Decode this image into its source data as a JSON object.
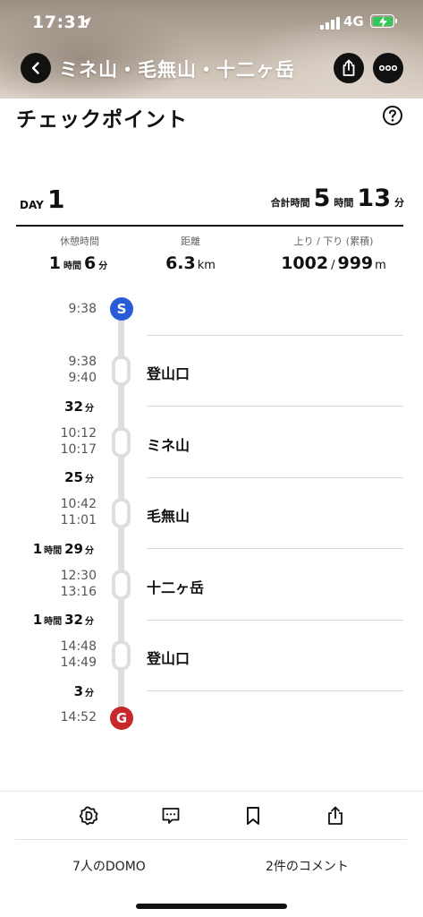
{
  "status_bar": {
    "time": "17:31",
    "network": "4G"
  },
  "header": {
    "title": "ミネ山・毛無山・十二ヶ岳",
    "back_icon": "chevron-left-icon",
    "share_icon": "share-icon",
    "more_icon": "more-dots-icon"
  },
  "checkpoint": {
    "title": "チェックポイント",
    "help_icon": "help-circle-icon",
    "day_label": "DAY",
    "day_number": "1",
    "total_label": "合計時間",
    "total_hours": "5",
    "hours_unit": "時間",
    "total_minutes": "13",
    "minutes_unit": "分",
    "stats": {
      "rest": {
        "label": "休憩時間",
        "hours": "1",
        "hours_unit": "時間",
        "minutes": "6",
        "minutes_unit": "分"
      },
      "distance": {
        "label": "距離",
        "value": "6.3",
        "unit": "km"
      },
      "elevation": {
        "label": "上り / 下り (累積)",
        "up": "1002",
        "separator": "/",
        "down": "999",
        "unit": "m"
      }
    }
  },
  "timeline": {
    "start": {
      "marker": "S",
      "time": "9:38"
    },
    "checkpoints": [
      {
        "arrive": "9:38",
        "depart": "9:40",
        "name": "登山口"
      },
      {
        "arrive": "10:12",
        "depart": "10:17",
        "name": "ミネ山"
      },
      {
        "arrive": "10:42",
        "depart": "11:01",
        "name": "毛無山"
      },
      {
        "arrive": "12:30",
        "depart": "13:16",
        "name": "十二ヶ岳"
      },
      {
        "arrive": "14:48",
        "depart": "14:49",
        "name": "登山口"
      }
    ],
    "durations": [
      {
        "hours": "",
        "minutes": "32"
      },
      {
        "hours": "",
        "minutes": "25"
      },
      {
        "hours": "1",
        "minutes": "29"
      },
      {
        "hours": "1",
        "minutes": "32"
      },
      {
        "hours": "",
        "minutes": "3"
      }
    ],
    "hours_unit": "時間",
    "minutes_unit": "分",
    "goal": {
      "marker": "G",
      "time": "14:52"
    }
  },
  "bottom_bar": {
    "actions": [
      "domo-icon",
      "comment-icon",
      "bookmark-icon",
      "share-icon"
    ],
    "domo_count_label": "7人のDOMO",
    "comment_count_label": "2件のコメント"
  },
  "colors": {
    "start_marker": "#2a5bd7",
    "goal_marker": "#c8282b",
    "timeline_line": "#dedede",
    "battery": "#34c759"
  }
}
